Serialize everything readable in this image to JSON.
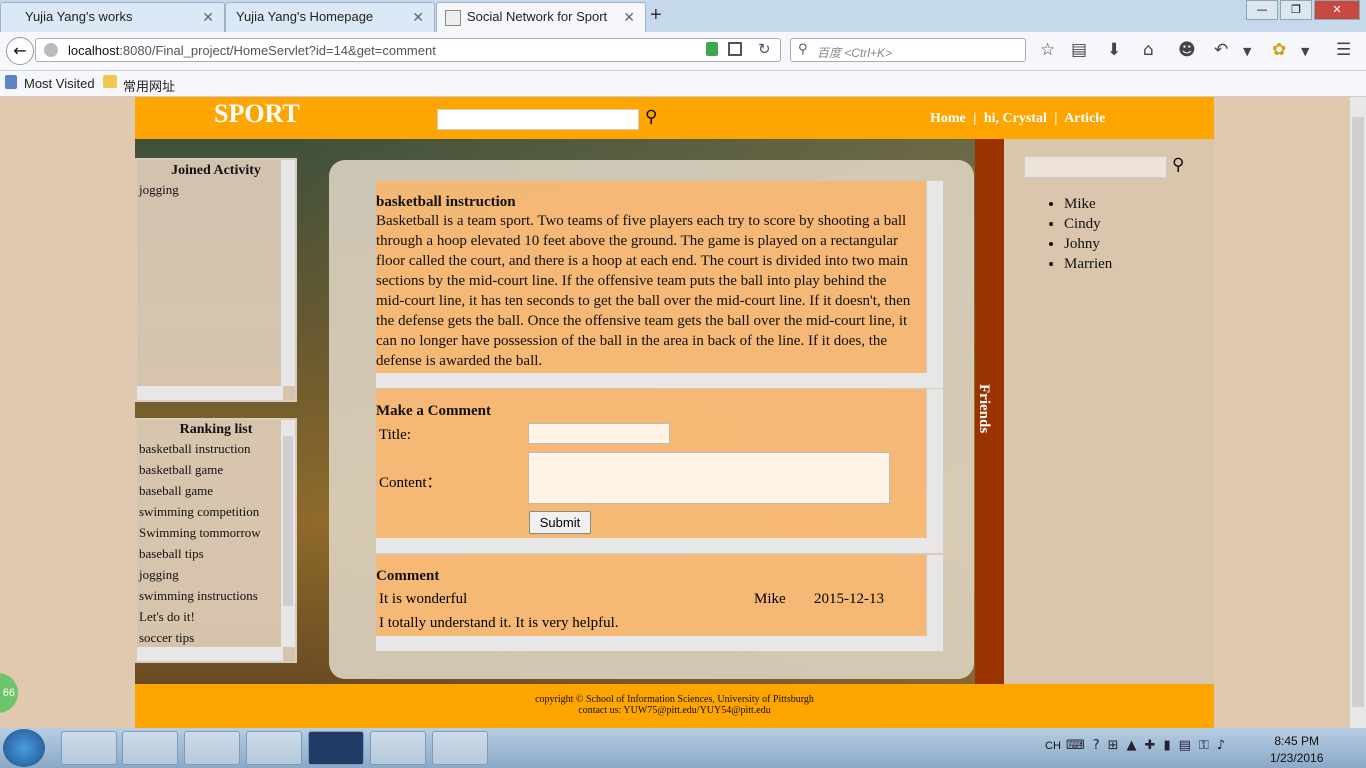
{
  "browser": {
    "tabs": [
      {
        "label": "Yujia Yang's works"
      },
      {
        "label": "Yujia Yang's Homepage"
      },
      {
        "label": "Social Network for Sport"
      }
    ],
    "new_tab": "+",
    "url_host": "localhost",
    "url_rest": ":8080/Final_project/HomeServlet?id=14&get=comment",
    "search_placeholder": "百度 <Ctrl+K>",
    "bookmarks": [
      "Most Visited",
      "常用网址"
    ]
  },
  "site": {
    "logo": "SPORT",
    "nav": {
      "home": "Home",
      "sep": "|",
      "user": "hi, Crystal",
      "article": "Article"
    }
  },
  "joined": {
    "title": "Joined Activity",
    "items": [
      "jogging"
    ]
  },
  "ranking": {
    "title": "Ranking list",
    "items": [
      "basketball instruction",
      "basketball game",
      "baseball game",
      "swimming competition",
      "Swimming tommorrow",
      "baseball tips",
      "jogging",
      "swimming instructions",
      "Let's do it!",
      "soccer tips"
    ]
  },
  "article": {
    "title": "basketball instruction",
    "body": "Basketball is a team sport. Two teams of five players each try to score by shooting a ball through a hoop elevated 10 feet above the ground. The game is played on a rectangular floor called the court, and there is a hoop at each end. The court is divided into two main sections by the mid-court line. If the offensive team puts the ball into play behind the mid-court line, it has ten seconds to get the ball over the mid-court line. If it doesn't, then the defense gets the ball. Once the offensive team gets the ball over the mid-court line, it can no longer have possession of the ball in the area in back of the line. If it does, the defense is awarded the ball."
  },
  "comment_form": {
    "heading": "Make a Comment",
    "title_label": "Title:",
    "content_label": "Content：",
    "submit": "Submit"
  },
  "comments": {
    "heading": "Comment",
    "items": [
      {
        "title": "It is wonderful",
        "author": "Mike",
        "date": "2015-12-13",
        "text": "I totally understand it. It is very helpful."
      }
    ]
  },
  "friends": {
    "label": "Friends",
    "list": [
      "Mike",
      "Cindy",
      "Johny",
      "Marrien"
    ]
  },
  "footer": {
    "line1": "copyright © School of Information Sciences, University of Pittsburgh",
    "line2": "contact us: YUW75@pitt.edu/YUY54@pitt.edu"
  },
  "taskbar": {
    "lang": "CH",
    "time": "8:45 PM",
    "date": "1/23/2016",
    "badge": "66"
  },
  "colors": {
    "accent": "#ffa500",
    "friends_bar": "#993300"
  }
}
